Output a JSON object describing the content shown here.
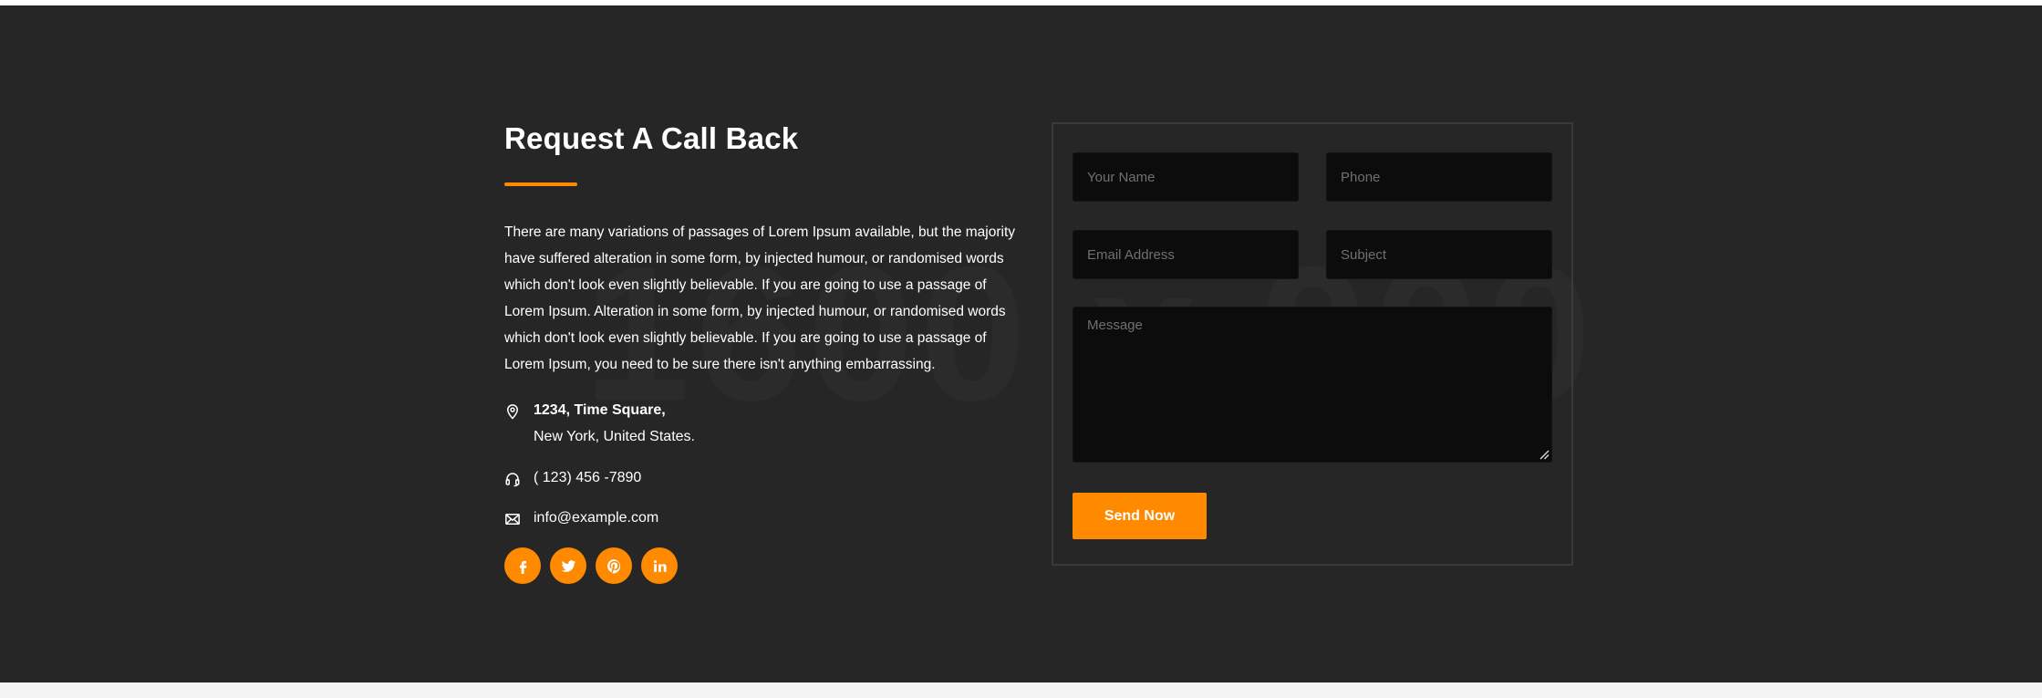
{
  "section": {
    "watermark": "1600 x 900",
    "title": "Request A Call Back",
    "description": "There are many variations of passages of Lorem Ipsum available, but the majority have suffered alteration in some form, by injected humour, or randomised words which don't look even slightly believable. If you are going to use a passage of Lorem Ipsum. Alteration in some form, by injected humour, or randomised words which don't look even slightly believable. If you are going to use a passage of Lorem Ipsum, you need to be sure there isn't anything embarrassing."
  },
  "contact": {
    "address_line1": "1234, Time Square,",
    "address_line2": "New York, United States.",
    "phone": "( 123) 456 -7890",
    "email": "info@example.com",
    "icons": [
      "map-pin-icon",
      "headset-icon",
      "envelope-icon"
    ]
  },
  "socials": [
    {
      "name": "facebook-icon"
    },
    {
      "name": "twitter-icon"
    },
    {
      "name": "pinterest-icon"
    },
    {
      "name": "linkedin-icon"
    }
  ],
  "form": {
    "name_placeholder": "Your Name",
    "phone_placeholder": "Phone",
    "email_placeholder": "Email Address",
    "subject_placeholder": "Subject",
    "message_placeholder": "Message",
    "submit_label": "Send Now"
  },
  "colors": {
    "background": "#262626",
    "accent": "#ff8a00",
    "input_background": "#0c0c0c",
    "text": "#ffffff",
    "placeholder": "#707070"
  }
}
